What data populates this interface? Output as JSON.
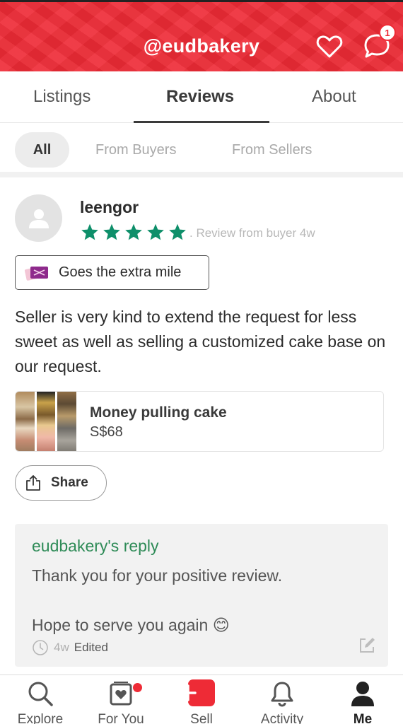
{
  "header": {
    "title": "@eudbakery",
    "notification_count": "1",
    "accent": "#ee2b36"
  },
  "tabs": [
    {
      "label": "Listings"
    },
    {
      "label": "Reviews"
    },
    {
      "label": "About"
    }
  ],
  "filters": [
    {
      "label": "All"
    },
    {
      "label": "From Buyers"
    },
    {
      "label": "From Sellers"
    }
  ],
  "review": {
    "username": "leengor",
    "rating": 5,
    "rating_max": 5,
    "meta": ". Review from buyer  4w",
    "badge": "Goes the extra mile",
    "text": "Seller is very kind to extend the request for less sweet as well as selling a customized cake base on our request.",
    "listing": {
      "title": "Money pulling cake",
      "price": "S$68"
    },
    "share_label": "Share",
    "star_color": "#0e8f6a"
  },
  "reply": {
    "title": "eudbakery's reply",
    "text": "Thank you for your positive review.\n\nHope to serve you again 😊",
    "time": "4w",
    "edited": "Edited",
    "title_color": "#2e8b57"
  },
  "nav": [
    {
      "label": "Explore",
      "icon": "search-icon"
    },
    {
      "label": "For You",
      "icon": "for-you-icon"
    },
    {
      "label": "Sell",
      "icon": "plus-icon"
    },
    {
      "label": "Activity",
      "icon": "bell-icon"
    },
    {
      "label": "Me",
      "icon": "person-icon"
    }
  ]
}
